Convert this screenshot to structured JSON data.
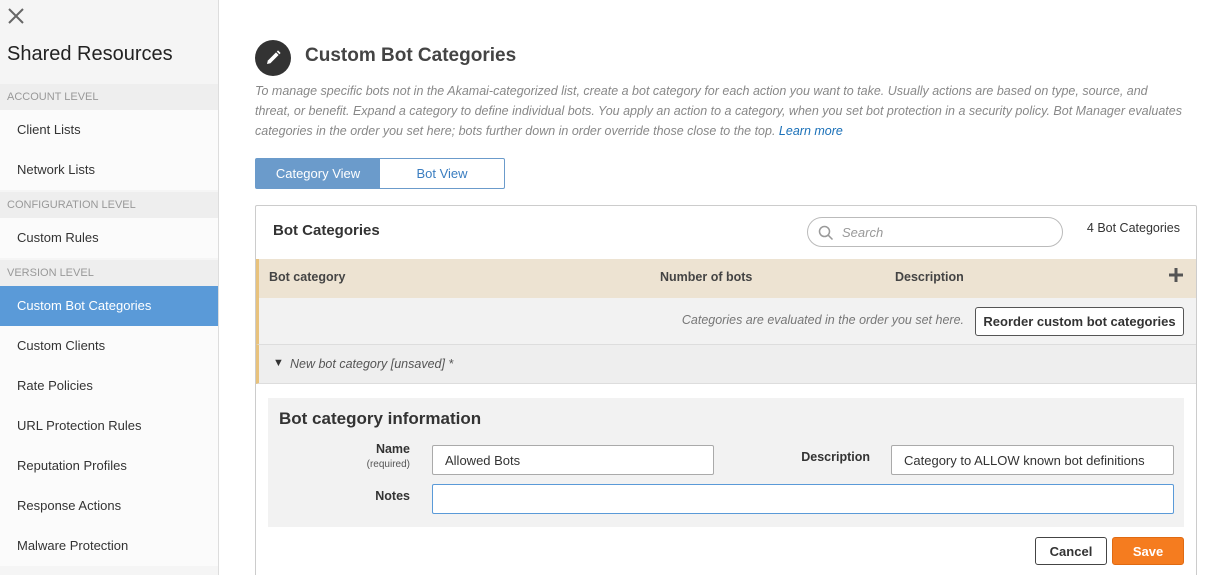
{
  "sidebar": {
    "title": "Shared Resources",
    "sections": [
      {
        "header": "ACCOUNT LEVEL",
        "items": [
          "Client Lists",
          "Network Lists"
        ]
      },
      {
        "header": "CONFIGURATION LEVEL",
        "items": [
          "Custom Rules"
        ]
      },
      {
        "header": "VERSION LEVEL",
        "items": [
          "Custom Bot Categories",
          "Custom Clients",
          "Rate Policies",
          "URL Protection Rules",
          "Reputation Profiles",
          "Response Actions",
          "Malware Protection"
        ]
      }
    ],
    "active_item": "Custom Bot Categories"
  },
  "page": {
    "title": "Custom Bot Categories",
    "icon": "pencil-icon",
    "description": "To manage specific bots not in the Akamai-categorized list, create a bot category for each action you want to take. Usually actions are based on type, source, and threat, or benefit. Expand a category to define individual bots. You apply an action to a category, when you set bot protection in a security policy. Bot Manager evaluates categories in the order you set here; bots further down in order override those close to the top.",
    "learn_more": "Learn more"
  },
  "tabs": [
    {
      "label": "Category View",
      "active": true
    },
    {
      "label": "Bot View",
      "active": false
    }
  ],
  "panel": {
    "title": "Bot Categories",
    "search_placeholder": "Search",
    "count": "4 Bot Categories",
    "columns": [
      "Bot category",
      "Number of bots",
      "Description"
    ],
    "reorder_note": "Categories are evaluated in the order you set here.",
    "reorder_button": "Reorder custom bot categories",
    "new_category": "New bot category [unsaved] *"
  },
  "form": {
    "title": "Bot category information",
    "name_label": "Name",
    "name_required": "(required)",
    "name_value": "Allowed Bots",
    "description_label": "Description",
    "description_value": "Category to ALLOW known bot definitions",
    "notes_label": "Notes",
    "notes_value": "",
    "cancel": "Cancel",
    "save": "Save"
  },
  "colors": {
    "active_nav": "#5a9ad8",
    "tab_active": "#6b9bcb",
    "table_header": "#ede3d2",
    "accent_border": "#e8c27c",
    "save_button": "#f57c1f"
  }
}
